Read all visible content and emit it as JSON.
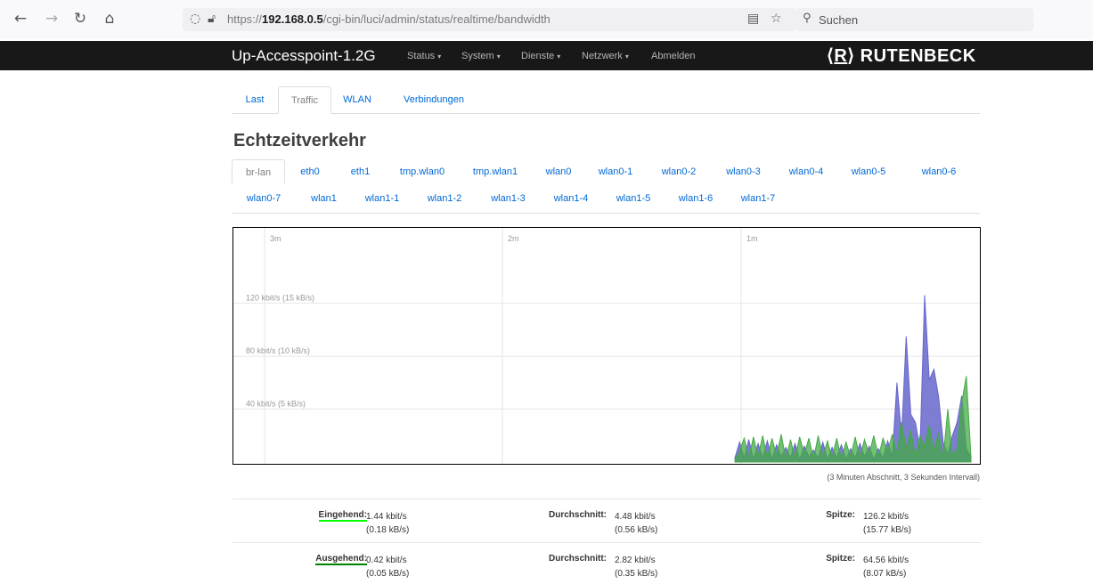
{
  "browser": {
    "url_prefix": "https://",
    "url_host": "192.168.0.5",
    "url_path": "/cgi-bin/luci/admin/status/realtime/bandwidth",
    "search_placeholder": "Suchen"
  },
  "header": {
    "brand": "Up-Accesspoint-1.2G",
    "menu": [
      "Status",
      "System",
      "Dienste",
      "Netzwerk",
      "Abmelden"
    ],
    "logo_mark": "R",
    "logo_text": "RUTENBECK"
  },
  "tabs": [
    "Last",
    "Traffic",
    "WLAN",
    "Verbindungen"
  ],
  "active_tab": "Traffic",
  "page_title": "Echtzeitverkehr",
  "interfaces": [
    "br-lan",
    "eth0",
    "eth1",
    "tmp.wlan0",
    "tmp.wlan1",
    "wlan0",
    "wlan0-1",
    "wlan0-2",
    "wlan0-3",
    "wlan0-4",
    "wlan0-5",
    "wlan0-6",
    "wlan0-7",
    "wlan1",
    "wlan1-1",
    "wlan1-2",
    "wlan1-3",
    "wlan1-4",
    "wlan1-5",
    "wlan1-6",
    "wlan1-7"
  ],
  "active_interface": "br-lan",
  "chart_data": {
    "type": "area",
    "time_labels": [
      "3m",
      "2m",
      "1m"
    ],
    "y_labels": [
      "120 kbit/s (15 kB/s)",
      "80 kbit/s (10 kB/s)",
      "40 kbit/s (5 kB/s)"
    ],
    "y_unit": "kbit/s",
    "ylim": [
      0,
      150
    ],
    "grid": true,
    "colors": {
      "rx": "#6666cc",
      "tx": "#44aa44"
    },
    "series": [
      {
        "name": "Eingehend",
        "values": [
          3,
          15,
          3,
          17,
          2,
          14,
          3,
          16,
          2,
          13,
          4,
          11,
          3,
          14,
          2,
          12,
          4,
          9,
          3,
          15,
          2,
          11,
          3,
          13,
          2,
          10,
          3,
          14,
          4,
          12,
          2,
          10,
          3,
          16,
          4,
          60,
          20,
          95,
          36,
          30,
          10,
          126,
          62,
          70,
          50,
          15,
          6,
          20,
          30,
          50,
          10,
          4
        ]
      },
      {
        "name": "Ausgehend",
        "values": [
          2,
          8,
          18,
          3,
          19,
          4,
          20,
          3,
          18,
          5,
          21,
          2,
          17,
          3,
          19,
          6,
          18,
          2,
          20,
          4,
          16,
          3,
          18,
          2,
          15,
          4,
          19,
          3,
          17,
          6,
          20,
          4,
          18,
          8,
          21,
          6,
          30,
          10,
          24,
          4,
          20,
          12,
          28,
          8,
          22,
          3,
          40,
          5,
          10,
          45,
          65,
          4
        ]
      }
    ],
    "note": "(3 Minuten Abschnitt, 3 Sekunden Intervall)"
  },
  "stats": {
    "in_label": "Eingehend:",
    "in_now_kbit": "1.44 kbit/s",
    "in_now_kb": "(0.18 kB/s)",
    "in_avg_label": "Durchschnitt:",
    "in_avg_kbit": "4.48 kbit/s",
    "in_avg_kb": "(0.56 kB/s)",
    "in_peak_label": "Spitze:",
    "in_peak_kbit": "126.2 kbit/s",
    "in_peak_kb": "(15.77 kB/s)",
    "out_label": "Ausgehend:",
    "out_now_kbit": "0.42 kbit/s",
    "out_now_kb": "(0.05 kB/s)",
    "out_avg_label": "Durchschnitt:",
    "out_avg_kbit": "2.82 kbit/s",
    "out_avg_kb": "(0.35 kB/s)",
    "out_peak_label": "Spitze:",
    "out_peak_kbit": "64.56 kbit/s",
    "out_peak_kb": "(8.07 kB/s)"
  }
}
